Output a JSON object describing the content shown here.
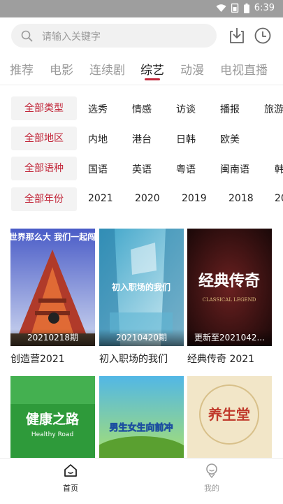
{
  "status": {
    "time": "6:39",
    "icons": [
      "wifi-icon",
      "battery-icon"
    ]
  },
  "search": {
    "placeholder": "请输入关键字"
  },
  "header_icons": [
    "download-icon",
    "history-clock-icon"
  ],
  "tabs": [
    {
      "label": "推荐",
      "active": false
    },
    {
      "label": "电影",
      "active": false
    },
    {
      "label": "连续剧",
      "active": false
    },
    {
      "label": "综艺",
      "active": true
    },
    {
      "label": "动漫",
      "active": false
    },
    {
      "label": "电视直播",
      "active": false
    }
  ],
  "filters": [
    {
      "label": "全部类型",
      "options": [
        "选秀",
        "情感",
        "访谈",
        "播报",
        "旅游"
      ]
    },
    {
      "label": "全部地区",
      "options": [
        "内地",
        "港台",
        "日韩",
        "欧美"
      ]
    },
    {
      "label": "全部语种",
      "options": [
        "国语",
        "英语",
        "粤语",
        "闽南语",
        "韩"
      ]
    },
    {
      "label": "全部年份",
      "options": [
        "2021",
        "2020",
        "2019",
        "2018",
        "20"
      ]
    }
  ],
  "cards": [
    {
      "title": "创造营2021",
      "episode": "20210218期",
      "poster_text": "世界那么大 我们一起闯"
    },
    {
      "title": "初入职场的我们",
      "episode": "20210420期",
      "poster_text": "初入职场的我们"
    },
    {
      "title": "经典传奇 2021",
      "episode": "更新至2021042...",
      "poster_text": "经典传奇"
    },
    {
      "title": "",
      "episode": "",
      "poster_text": "健康之路"
    },
    {
      "title": "",
      "episode": "",
      "poster_text": "男生女生向前冲"
    },
    {
      "title": "",
      "episode": "",
      "poster_text": "养生堂"
    }
  ],
  "colors": {
    "accent": "#c2273a",
    "status_bar": "#9e9e9e"
  },
  "bottom_nav": [
    {
      "label": "首页",
      "active": true,
      "icon": "home-icon"
    },
    {
      "label": "我的",
      "active": false,
      "icon": "profile-icon"
    }
  ]
}
